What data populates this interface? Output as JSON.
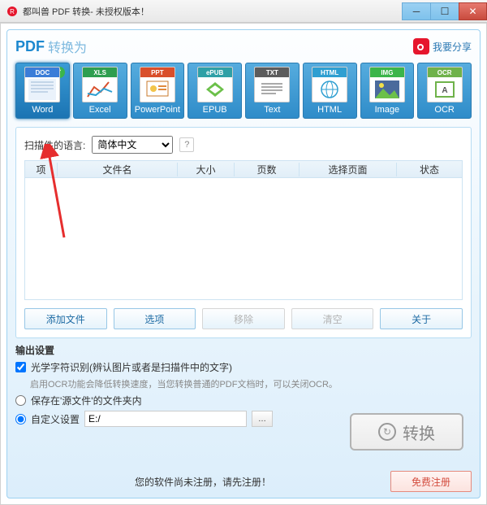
{
  "titlebar": {
    "title": "都叫兽 PDF 转换- 未授权版本！"
  },
  "header": {
    "title": "PDF",
    "subtitle": "转换为",
    "share_label": "我要分享"
  },
  "tiles": [
    {
      "label": "Word",
      "band": "DOC",
      "band_color": "#3b7dd8"
    },
    {
      "label": "Excel",
      "band": "XLS",
      "band_color": "#2e9e4f"
    },
    {
      "label": "PowerPoint",
      "band": "PPT",
      "band_color": "#d94f2b"
    },
    {
      "label": "EPUB",
      "band": "ePUB",
      "band_color": "#2fa0a6"
    },
    {
      "label": "Text",
      "band": "TXT",
      "band_color": "#5c5c5c"
    },
    {
      "label": "HTML",
      "band": "HTML",
      "band_color": "#2f9fd1"
    },
    {
      "label": "Image",
      "band": "IMG",
      "band_color": "#3bb54a"
    },
    {
      "label": "OCR",
      "band": "OCR",
      "band_color": "#6fb24a"
    }
  ],
  "lang": {
    "label": "扫描件的语言:",
    "selected": "简体中文"
  },
  "table": {
    "headers": {
      "idx": "项",
      "name": "文件名",
      "size": "大小",
      "pages": "页数",
      "sel": "选择页面",
      "status": "状态"
    }
  },
  "buttons": {
    "add": "添加文件",
    "options": "选项",
    "remove": "移除",
    "clear": "清空",
    "about": "关于"
  },
  "output": {
    "title": "输出设置",
    "ocr_label": "光学字符识别(辨认图片或者是扫描件中的文字)",
    "ocr_hint": "启用OCR功能会降低转换速度，当您转换普通的PDF文档时，可以关闭OCR。",
    "save_src": "保存在'源文件'的文件夹内",
    "custom": "自定义设置",
    "path": "E:/"
  },
  "convert": {
    "label": "转换"
  },
  "footer": {
    "text": "您的软件尚未注册，请先注册！",
    "register": "免费注册"
  }
}
